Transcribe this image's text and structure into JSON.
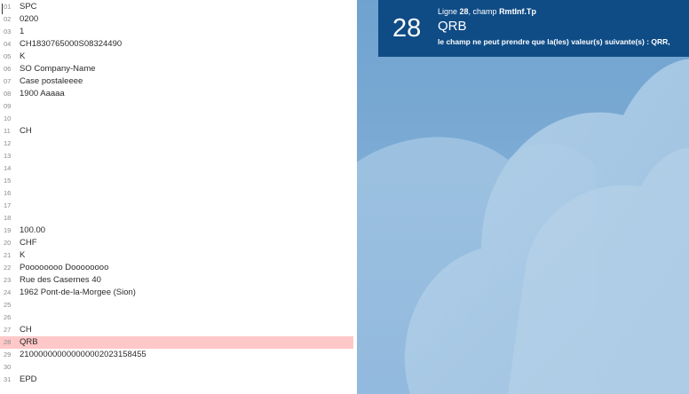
{
  "editor": {
    "lines": [
      {
        "num": "01",
        "text": "SPC"
      },
      {
        "num": "02",
        "text": "0200"
      },
      {
        "num": "03",
        "text": "1"
      },
      {
        "num": "04",
        "text": "CH1830765000S08324490"
      },
      {
        "num": "05",
        "text": "K"
      },
      {
        "num": "06",
        "text": "SO Company-Name"
      },
      {
        "num": "07",
        "text": "Case postaleeee"
      },
      {
        "num": "08",
        "text": "1900 Aaaaa"
      },
      {
        "num": "09",
        "text": ""
      },
      {
        "num": "10",
        "text": ""
      },
      {
        "num": "11",
        "text": "CH"
      },
      {
        "num": "12",
        "text": ""
      },
      {
        "num": "13",
        "text": ""
      },
      {
        "num": "14",
        "text": ""
      },
      {
        "num": "15",
        "text": ""
      },
      {
        "num": "16",
        "text": ""
      },
      {
        "num": "17",
        "text": ""
      },
      {
        "num": "18",
        "text": ""
      },
      {
        "num": "19",
        "text": "100.00"
      },
      {
        "num": "20",
        "text": "CHF"
      },
      {
        "num": "21",
        "text": "K"
      },
      {
        "num": "22",
        "text": "Poooooooo Doooooooo"
      },
      {
        "num": "23",
        "text": "Rue des Casernes 40"
      },
      {
        "num": "24",
        "text": "1962 Pont-de-la-Morgee (Sion)"
      },
      {
        "num": "25",
        "text": ""
      },
      {
        "num": "26",
        "text": ""
      },
      {
        "num": "27",
        "text": "CH"
      },
      {
        "num": "28",
        "text": "QRB",
        "error": true
      },
      {
        "num": "29",
        "text": "210000000000000002023158455"
      },
      {
        "num": "30",
        "text": ""
      },
      {
        "num": "31",
        "text": "EPD"
      }
    ]
  },
  "error_panel": {
    "line_number": "28",
    "heading_prefix": "Ligne ",
    "heading_line": "28",
    "heading_middle": ", champ ",
    "heading_field": "RmtInf.Tp",
    "value": "QRB",
    "message": "le champ ne peut prendre que la(les) valeur(s) suivante(s) : QRR,",
    "background_color": "#0f4c86",
    "error_highlight_color": "#fec8c8"
  }
}
